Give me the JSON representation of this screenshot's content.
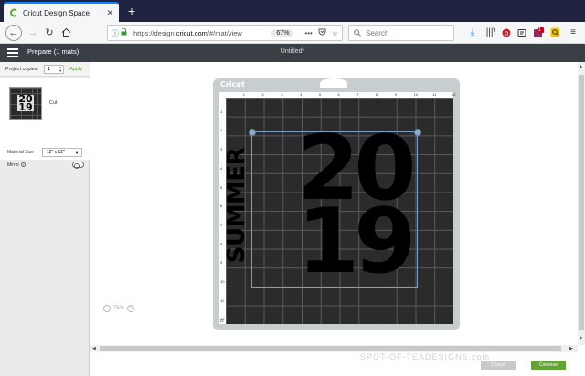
{
  "browser": {
    "tab_title": "Cricut Design Space",
    "tab_close": "✕",
    "new_tab": "+",
    "url_prefix": "https://design.",
    "url_domain": "cricut.com",
    "url_suffix": "/#/mat/view",
    "zoom": "67%",
    "search_placeholder": "Search",
    "extension_badge": "1"
  },
  "app": {
    "header_title": "Prepare (1 mats)",
    "document_title": "Untitled*"
  },
  "sidebar": {
    "copies_label": "Project copies:",
    "copies_value": "1",
    "apply_label": "Apply",
    "mat_label": "Cut",
    "thumb_line1": "20",
    "thumb_line2": "19",
    "material_size_label": "Material Size",
    "material_size_value": "12\" x 12\"",
    "mirror_label": "Mirror",
    "info_glyph": "i"
  },
  "mat": {
    "brand": "Cricut",
    "top_ticks": [
      "1",
      "2",
      "3",
      "4",
      "5",
      "6",
      "7",
      "8",
      "9",
      "10",
      "11",
      "12"
    ],
    "left_ticks": [
      "1",
      "2",
      "3",
      "4",
      "5",
      "6",
      "7",
      "8",
      "9",
      "10",
      "11",
      "12"
    ],
    "bottom_tick": "13",
    "design_vertical": "SUMMER",
    "design_line1": "20",
    "design_line2": "19"
  },
  "canvas": {
    "zoom_level": "75%",
    "zoom_out": "−",
    "zoom_in": "+"
  },
  "footer": {
    "cancel_label": "Cancel",
    "continue_label": "Continue",
    "watermark": "SPOT-OF-TEADESIGNS.com"
  }
}
